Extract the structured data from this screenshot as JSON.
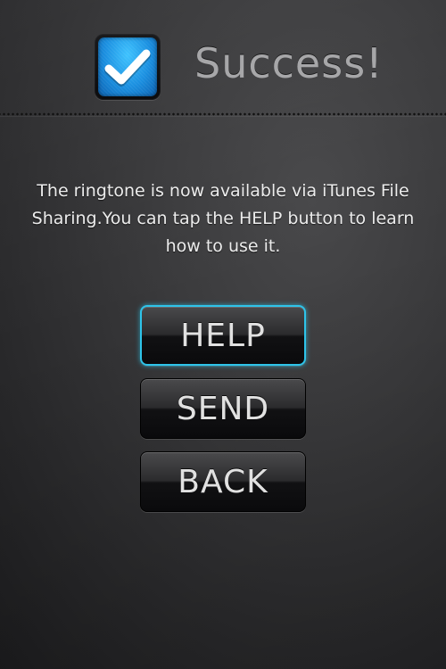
{
  "header": {
    "title": "Success!",
    "icon": "checkmark-icon"
  },
  "message": {
    "text": "The ringtone is now available via iTunes File Sharing.You can tap the HELP button to learn how to use it."
  },
  "buttons": {
    "help_label": "HELP",
    "send_label": "SEND",
    "back_label": "BACK"
  },
  "colors": {
    "accent": "#2ec4ea",
    "icon_blue": "#1b8fe0",
    "title_gray": "#a7a7a9"
  }
}
